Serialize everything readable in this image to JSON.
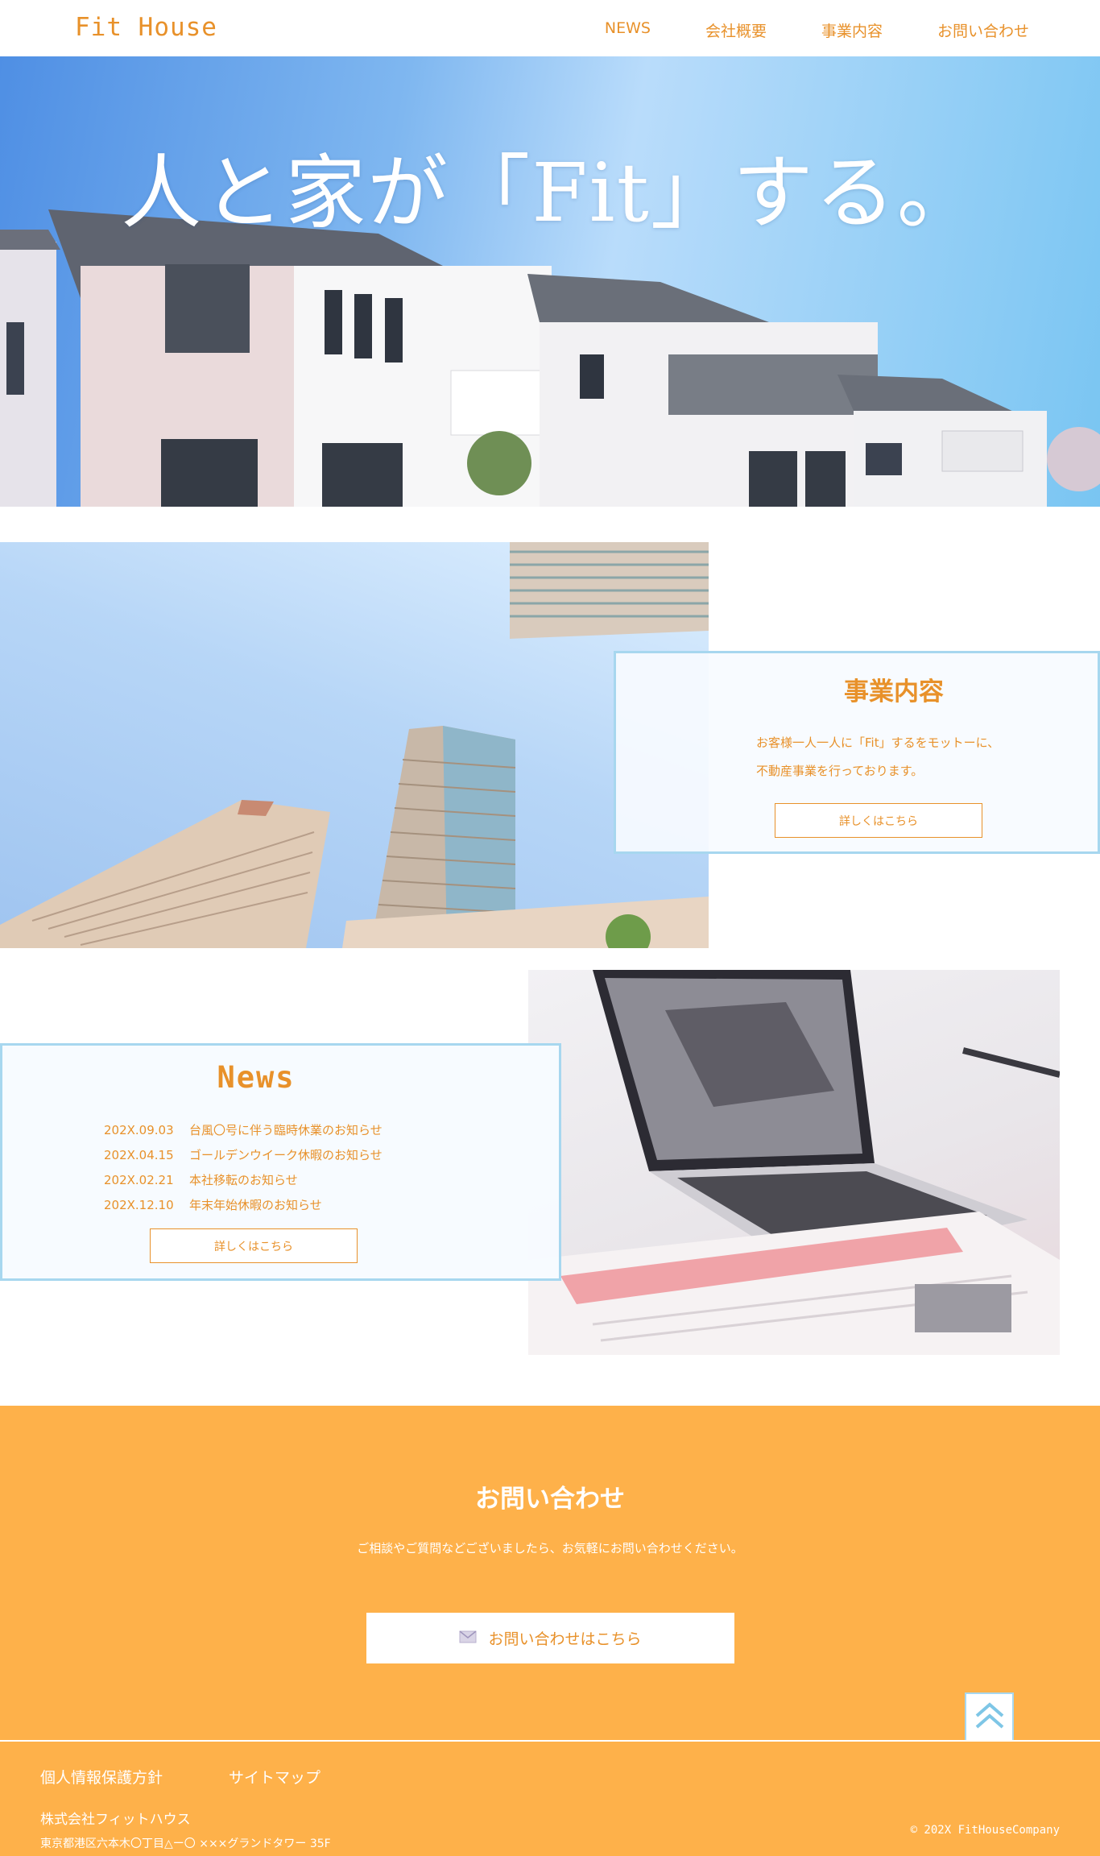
{
  "header": {
    "logo": "Fit House",
    "nav": [
      {
        "label": "NEWS"
      },
      {
        "label": "会社概要"
      },
      {
        "label": "事業内容"
      },
      {
        "label": "お問い合わせ"
      }
    ]
  },
  "hero": {
    "title": "人と家が「Fit」する。"
  },
  "business": {
    "title": "事業内容",
    "text_lines": [
      "お客様一人一人に「Fit」するをモットーに、",
      "不動産事業を行っております。"
    ],
    "button": "詳しくはこちら"
  },
  "news": {
    "title": "News",
    "items": [
      {
        "date": "202X.09.03",
        "text": "台風〇号に伴う臨時休業のお知らせ"
      },
      {
        "date": "202X.04.15",
        "text": "ゴールデンウイーク休暇のお知らせ"
      },
      {
        "date": "202X.02.21",
        "text": "本社移転のお知らせ"
      },
      {
        "date": "202X.12.10",
        "text": "年末年始休暇のお知らせ"
      }
    ],
    "button": "詳しくはこちら"
  },
  "contact": {
    "title": "お問い合わせ",
    "text": "ご相談やご質問などございましたら、お気軽にお問い合わせください。",
    "button": "お問い合わせはこちら",
    "button_icon": "mail-icon",
    "to_top_icon": "chevron-up-icon"
  },
  "footer": {
    "links": [
      "個人情報保護方針",
      "サイトマップ"
    ],
    "company": "株式会社フィットハウス",
    "address": "東京都港区六本木〇丁目△ー〇 ×××グランドタワー 35F",
    "copyright": "© 202X FitHouseCompany"
  },
  "colors": {
    "accent": "#e8912a",
    "contact_bg": "#feb14a",
    "card_border": "#a7d7ef"
  }
}
